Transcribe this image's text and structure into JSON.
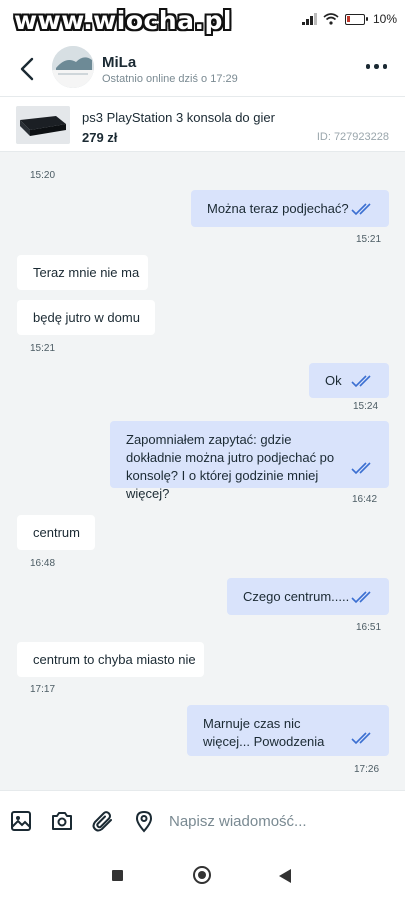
{
  "watermark": "www.wiocha.pl",
  "status_bar": {
    "battery": "10%",
    "icons": [
      "signal-icon",
      "wifi-icon",
      "battery-icon"
    ]
  },
  "header": {
    "contact_name": "MiLa",
    "contact_status": "Ostatnio online dziś o 17:29",
    "icons": [
      "back-arrow-icon",
      "more-options-icon"
    ]
  },
  "product": {
    "title": "ps3 PlayStation 3 konsola do gier",
    "price": "279 zł",
    "id": "ID: 727923228"
  },
  "messages": [
    {
      "dir": "out",
      "text": "Można teraz podjechać?",
      "time": "15:21",
      "read": true
    },
    {
      "dir": "in",
      "text": "Teraz mnie nie ma",
      "time": ""
    },
    {
      "dir": "in",
      "text": "będę jutro w domu",
      "time": "15:21"
    },
    {
      "dir": "out",
      "text": "Ok",
      "time": "15:24",
      "read": true
    },
    {
      "dir": "out",
      "text": "Zapomniałem zapytać: gdzie dokładnie można jutro podjechać po konsolę? I o której godzinie mniej więcej?",
      "time": "16:42",
      "read": true
    },
    {
      "dir": "in",
      "text": "centrum",
      "time": "16:48"
    },
    {
      "dir": "out",
      "text": "Czego centrum.....",
      "time": "16:51",
      "read": true
    },
    {
      "dir": "in",
      "text": "centrum to chyba miasto nie",
      "time": "17:17"
    },
    {
      "dir": "out",
      "text": "Marnuje czas nic więcej... Powodzenia",
      "time": "17:26",
      "read": true
    }
  ],
  "top_timestamp": "15:20",
  "composer": {
    "placeholder": "Napisz wiadomość...",
    "tools": [
      "image-icon",
      "camera-icon",
      "attach-icon",
      "location-icon"
    ]
  },
  "colors": {
    "outgoing_bubble": "#d9e3fb",
    "incoming_bubble": "#ffffff",
    "read_check": "#3b6fd1",
    "background": "#f2f4f5"
  }
}
